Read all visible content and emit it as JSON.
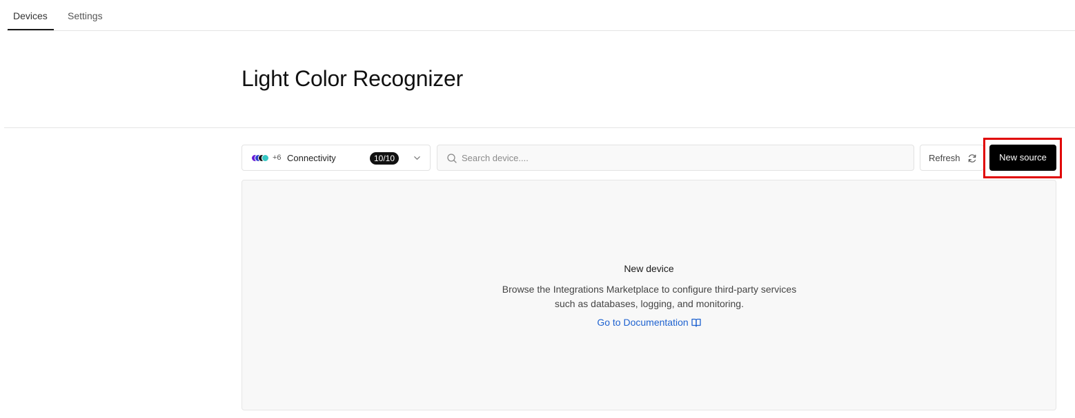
{
  "tabs": {
    "devices": "Devices",
    "settings": "Settings"
  },
  "page": {
    "title": "Light Color Recognizer"
  },
  "filter": {
    "more_count": "+6",
    "label": "Connectivity",
    "badge": "10/10",
    "dot_colors": [
      "#6a1fd6",
      "#2f3fd0",
      "#141414",
      "#36c7c4"
    ]
  },
  "search": {
    "placeholder": "Search device....",
    "value": ""
  },
  "toolbar": {
    "refresh_label": "Refresh",
    "new_source_label": "New source"
  },
  "empty_state": {
    "title": "New device",
    "description_line1": "Browse the Integrations Marketplace to configure third-party services",
    "description_line2": "such as databases, logging, and monitoring.",
    "link_label": "Go to Documentation"
  },
  "colors": {
    "highlight": "#e00000",
    "link": "#1e62d0",
    "button_bg": "#000000"
  }
}
